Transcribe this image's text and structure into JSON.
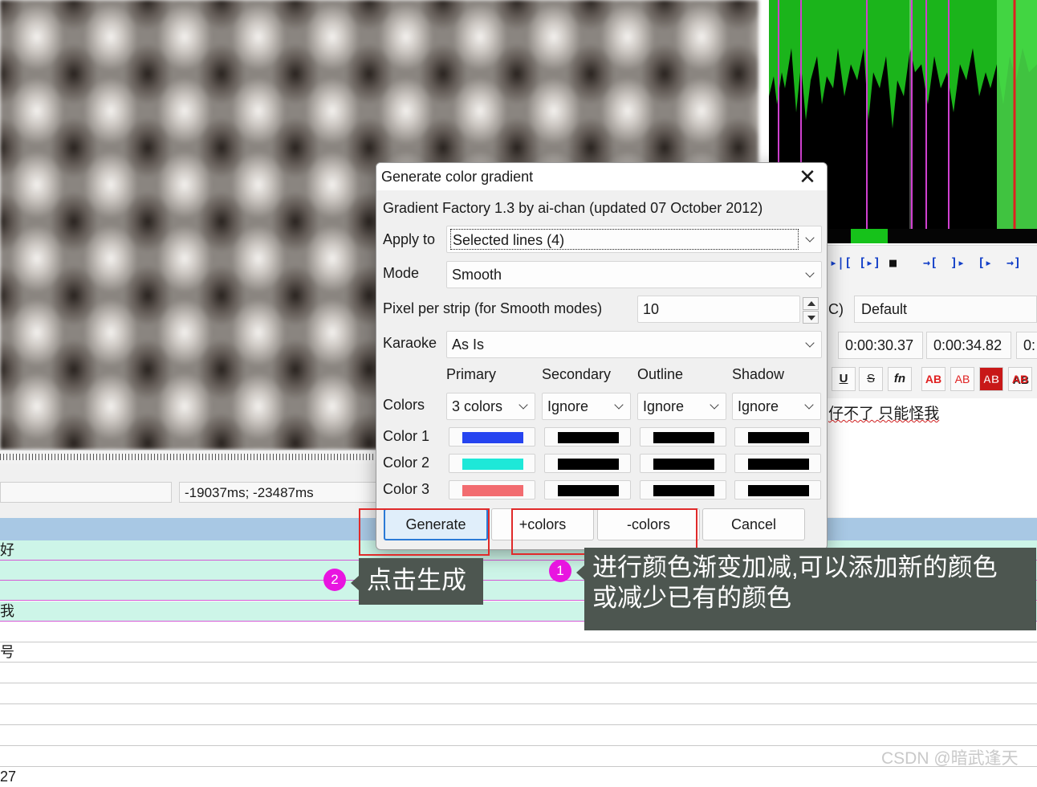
{
  "dialog": {
    "title": "Generate color gradient",
    "close_glyph": "✕",
    "header_text": "Gradient Factory 1.3 by ai-chan (updated 07 October 2012)",
    "apply_to": {
      "label": "Apply to",
      "value": "Selected lines (4)"
    },
    "mode": {
      "label": "Mode",
      "value": "Smooth"
    },
    "pixel_per_strip": {
      "label": "Pixel per strip (for Smooth modes)",
      "value": "10"
    },
    "karaoke": {
      "label": "Karaoke",
      "value": "As Is"
    },
    "columns": [
      "Primary",
      "Secondary",
      "Outline",
      "Shadow"
    ],
    "colors_row": {
      "label": "Colors",
      "values": [
        "3 colors",
        "Ignore",
        "Ignore",
        "Ignore"
      ]
    },
    "color_rows": [
      {
        "label": "Color 1",
        "swatches": [
          "#2644f0",
          "#000000",
          "#000000",
          "#000000"
        ]
      },
      {
        "label": "Color 2",
        "swatches": [
          "#1ee8d8",
          "#000000",
          "#000000",
          "#000000"
        ]
      },
      {
        "label": "Color 3",
        "swatches": [
          "#f26c70",
          "#000000",
          "#000000",
          "#000000"
        ]
      }
    ],
    "buttons": {
      "generate": "Generate",
      "add_colors": "+colors",
      "remove_colors": "-colors",
      "cancel": "Cancel"
    }
  },
  "annotations": {
    "callout_1": {
      "badge": "1",
      "text_line1": "进行颜色渐变加减,可以添加新的颜色",
      "text_line2": "或减少已有的颜色"
    },
    "callout_2": {
      "badge": "2",
      "text": "点击生成"
    },
    "accent_red": "#e02a2a",
    "badge_color": "#e815e0"
  },
  "background_app": {
    "video_time_field": "-19037ms; -23487ms",
    "style_field": "Default",
    "style_prefix": "C)",
    "start_time": "0:00:30.37",
    "end_time": "0:00:34.82",
    "extra_time": "0:",
    "edit_text": "仔不了 只能怪我",
    "format_buttons": [
      "U",
      "S",
      "fn",
      "AB",
      "AB",
      "AB",
      "AB"
    ],
    "grid_rows": [
      "好",
      "",
      "",
      "我",
      "",
      "号",
      "",
      "",
      "",
      "",
      "",
      "27"
    ]
  },
  "watermark": "CSDN @暗武逢天"
}
